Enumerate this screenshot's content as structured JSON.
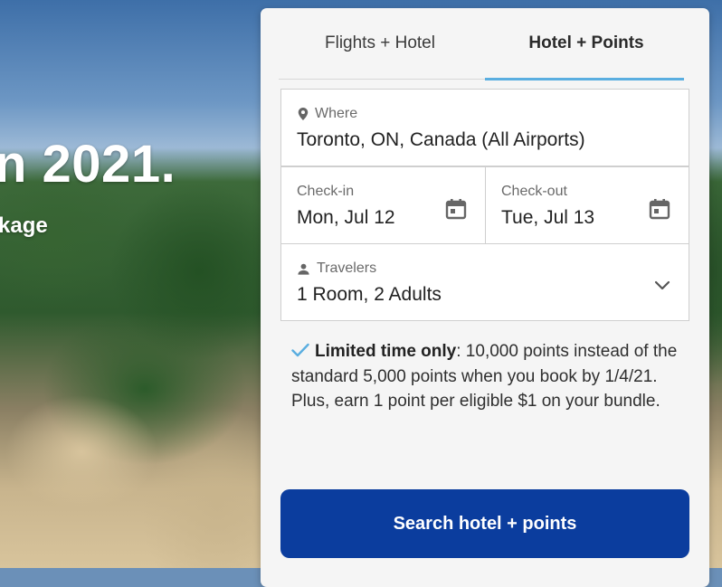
{
  "hero": {
    "title": "n 2021.",
    "subtitle": "kage"
  },
  "tabs": [
    {
      "label": "Flights + Hotel",
      "active": false
    },
    {
      "label": "Hotel + Points",
      "active": true
    }
  ],
  "where": {
    "label": "Where",
    "value": "Toronto, ON, Canada (All Airports)",
    "icon": "location-pin-icon"
  },
  "checkin": {
    "label": "Check-in",
    "value": "Mon, Jul 12",
    "icon": "calendar-icon"
  },
  "checkout": {
    "label": "Check-out",
    "value": "Tue, Jul 13",
    "icon": "calendar-icon"
  },
  "travelers": {
    "label": "Travelers",
    "value": "1 Room, 2 Adults",
    "icon": "person-icon"
  },
  "promo": {
    "bold": "Limited time only",
    "text": ": 10,000 points instead of the standard 5,000 points when you book by 1/4/21. Plus, earn 1 point per eligible $1 on your bundle."
  },
  "search_button": "Search hotel + points",
  "colors": {
    "accent": "#5aaee0",
    "button": "#0b3d9e",
    "check": "#5aaee0"
  }
}
